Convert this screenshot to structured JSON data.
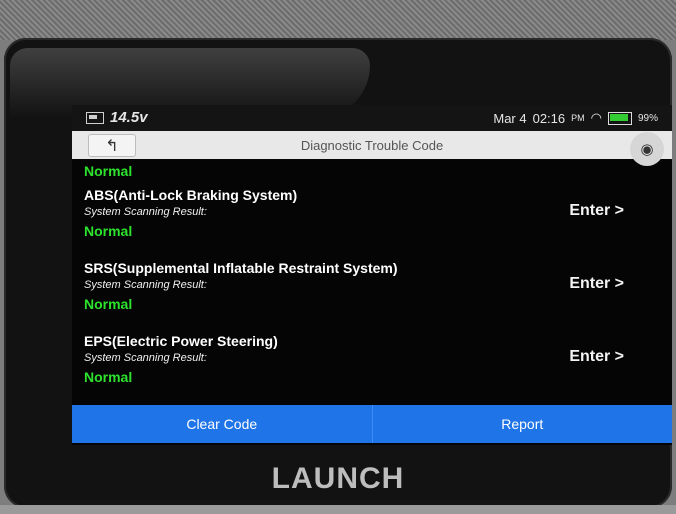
{
  "device": {
    "brand": "LAUNCH"
  },
  "status_bar": {
    "voltage": "14.5v",
    "date": "Mar 4",
    "time": "02:16",
    "ampm": "PM",
    "battery_pct": "99%"
  },
  "title_bar": {
    "title": "Diagnostic Trouble Code"
  },
  "partial_result": "Normal",
  "modules": [
    {
      "name": "ABS(Anti-Lock Braking System)",
      "scan_label": "System Scanning Result:",
      "result": "Normal",
      "enter_label": "Enter >"
    },
    {
      "name": "SRS(Supplemental Inflatable Restraint System)",
      "scan_label": "System Scanning Result:",
      "result": "Normal",
      "enter_label": "Enter >"
    },
    {
      "name": "EPS(Electric Power Steering)",
      "scan_label": "System Scanning Result:",
      "result": "Normal",
      "enter_label": "Enter >"
    }
  ],
  "actions": {
    "clear_code": "Clear Code",
    "report": "Report"
  },
  "colors": {
    "accent": "#1f74e8",
    "normal_status": "#2de22d",
    "battery": "#33cc33"
  },
  "icons": {
    "back": "back-arrow-icon",
    "camera": "camera-icon",
    "wifi": "wifi-icon",
    "battery": "battery-icon"
  }
}
